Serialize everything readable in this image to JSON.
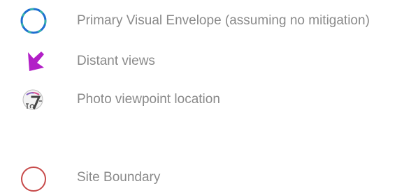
{
  "legend": {
    "items": [
      {
        "symbol": "dashed-circle-icon",
        "label": "Primary Visual Envelope (assuming no mitigation)",
        "colors": {
          "stroke": "#1f6fd1",
          "dash": "#35b7a5"
        }
      },
      {
        "symbol": "arrow-icon",
        "label": "Distant views",
        "colors": {
          "fill": "#b21fc7"
        }
      },
      {
        "symbol": "photo-viewpoint-icon",
        "label": "Photo viewpoint location",
        "colors": {
          "fill": "#5a5a5a",
          "accent": "#d64b8f"
        }
      },
      {
        "symbol": "site-boundary-icon",
        "label": "Site Boundary",
        "colors": {
          "stroke": "#c74a4a"
        }
      }
    ]
  }
}
